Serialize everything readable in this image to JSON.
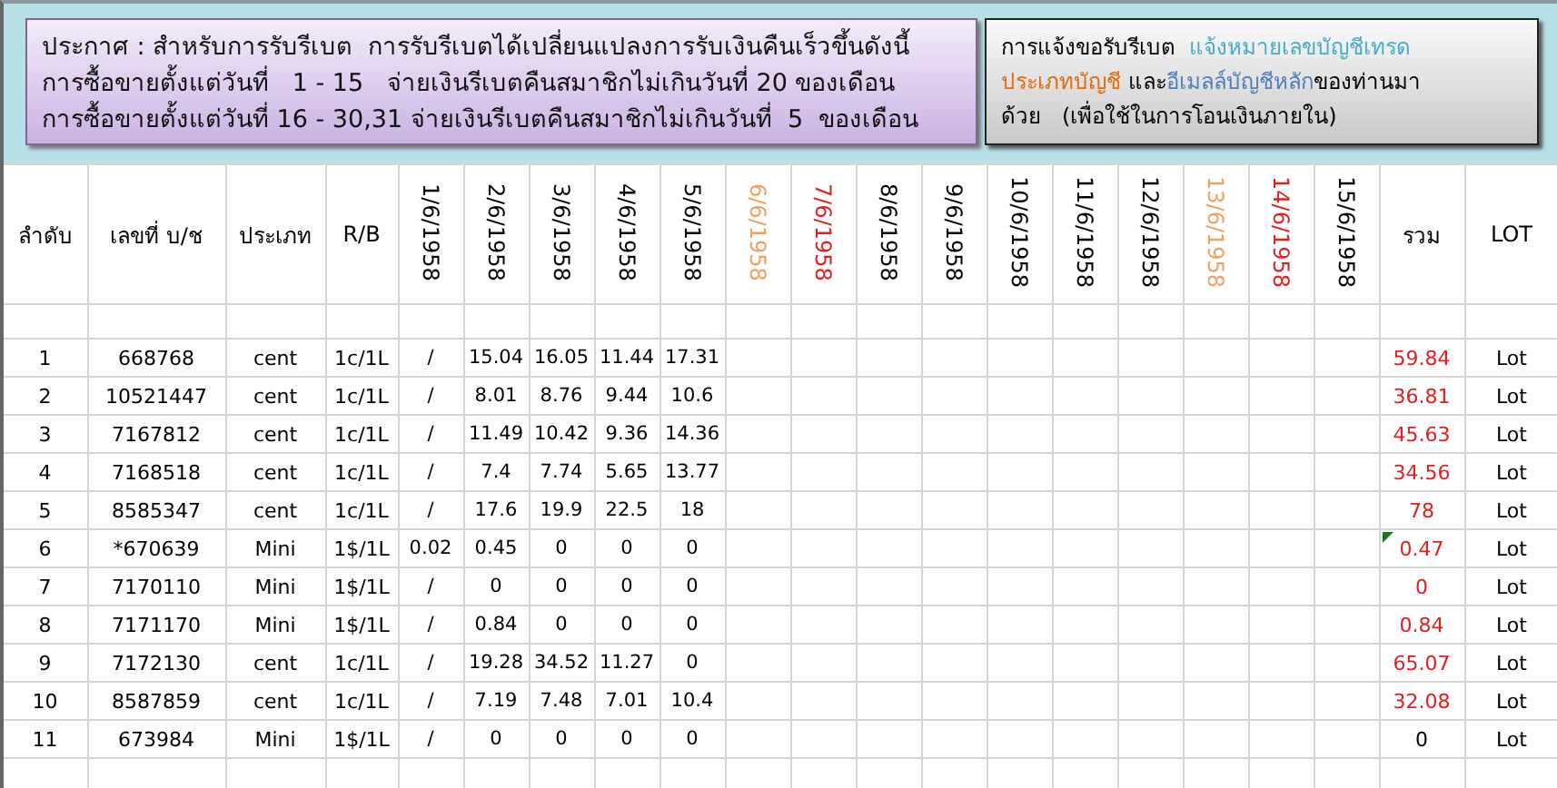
{
  "notice": {
    "lines": [
      "ประกาศ : สำหรับการรับรีเบต  การรับรีเบตได้เปลี่ยนแปลงการรับเงินคืนเร็วขึ้นดังนี้",
      "การซื้อขายตั้งแต่วันที่   1 - 15   จ่ายเงินรีเบตคืนสมาชิกไม่เกินวันที่ 20 ของเดือน",
      "การซื้อขายตั้งแต่วันที่ 16 - 30,31 จ่ายเงินรีเบตคืนสมาชิกไม่เกินวันที่  5  ของเดือน"
    ]
  },
  "request_note": {
    "lines": [
      [
        {
          "text": "การแจ้งขอรับรีเบต  ",
          "color": "#000000"
        },
        {
          "text": "แจ้งหมายเลขบัญชีเทรด",
          "color": "#4bacc6"
        }
      ],
      [
        {
          "text": "ประเภทบัญชี",
          "color": "#e46c0a"
        },
        {
          "text": " และ",
          "color": "#000000"
        },
        {
          "text": "อีเมลล์บัญชีหลัก",
          "color": "#4f81bd"
        },
        {
          "text": "ของท่านมา",
          "color": "#000000"
        }
      ],
      [
        {
          "text": "ด้วย   (เพื่อใช้ในการโอนเงินภายใน)",
          "color": "#000000"
        }
      ]
    ]
  },
  "table": {
    "columns": [
      {
        "label": "ลำดับ",
        "kind": "plain"
      },
      {
        "label": "เลขที่ บ/ช",
        "kind": "plain"
      },
      {
        "label": "ประเภท",
        "kind": "plain"
      },
      {
        "label": "R/B",
        "kind": "plain"
      },
      {
        "label": "1/6/1958",
        "kind": "date",
        "color": "#000000"
      },
      {
        "label": "2/6/1958",
        "kind": "date",
        "color": "#000000"
      },
      {
        "label": "3/6/1958",
        "kind": "date",
        "color": "#000000"
      },
      {
        "label": "4/6/1958",
        "kind": "date",
        "color": "#000000"
      },
      {
        "label": "5/6/1958",
        "kind": "date",
        "color": "#000000"
      },
      {
        "label": "6/6/1958",
        "kind": "date",
        "color": "#f0a060"
      },
      {
        "label": "7/6/1958",
        "kind": "date",
        "color": "#e02020"
      },
      {
        "label": "8/6/1958",
        "kind": "date",
        "color": "#000000"
      },
      {
        "label": "9/6/1958",
        "kind": "date",
        "color": "#000000"
      },
      {
        "label": "10/6/1958",
        "kind": "date",
        "color": "#000000"
      },
      {
        "label": "11/6/1958",
        "kind": "date",
        "color": "#000000"
      },
      {
        "label": "12/6/1958",
        "kind": "date",
        "color": "#000000"
      },
      {
        "label": "13/6/1958",
        "kind": "date",
        "color": "#f0a060"
      },
      {
        "label": "14/6/1958",
        "kind": "date",
        "color": "#e02020"
      },
      {
        "label": "15/6/1958",
        "kind": "date",
        "color": "#000000"
      },
      {
        "label": "รวม",
        "kind": "plain"
      },
      {
        "label": "LOT",
        "kind": "plain"
      }
    ],
    "rows": [
      {
        "no": "1",
        "account": "668768",
        "type": "cent",
        "rb": "1c/1L",
        "days": [
          "/",
          "15.04",
          "16.05",
          "11.44",
          "17.31"
        ],
        "total": "59.84",
        "color": "#e02020",
        "flagged": false,
        "lot": "Lot"
      },
      {
        "no": "2",
        "account": "10521447",
        "type": "cent",
        "rb": "1c/1L",
        "days": [
          "/",
          "8.01",
          "8.76",
          "9.44",
          "10.6"
        ],
        "total": "36.81",
        "color": "#e02020",
        "flagged": false,
        "lot": "Lot"
      },
      {
        "no": "3",
        "account": "7167812",
        "type": "cent",
        "rb": "1c/1L",
        "days": [
          "/",
          "11.49",
          "10.42",
          "9.36",
          "14.36"
        ],
        "total": "45.63",
        "color": "#e02020",
        "flagged": false,
        "lot": "Lot"
      },
      {
        "no": "4",
        "account": "7168518",
        "type": "cent",
        "rb": "1c/1L",
        "days": [
          "/",
          "7.4",
          "7.74",
          "5.65",
          "13.77"
        ],
        "total": "34.56",
        "color": "#e02020",
        "flagged": false,
        "lot": "Lot"
      },
      {
        "no": "5",
        "account": "8585347",
        "type": "cent",
        "rb": "1c/1L",
        "days": [
          "/",
          "17.6",
          "19.9",
          "22.5",
          "18"
        ],
        "total": "78",
        "color": "#e02020",
        "flagged": false,
        "lot": "Lot"
      },
      {
        "no": "6",
        "account": "*670639",
        "type": "Mini",
        "rb": "1$/1L",
        "days": [
          "0.02",
          "0.45",
          "0",
          "0",
          "0"
        ],
        "total": "0.47",
        "color": "#e02020",
        "flagged": true,
        "lot": "Lot"
      },
      {
        "no": "7",
        "account": "7170110",
        "type": "Mini",
        "rb": "1$/1L",
        "days": [
          "/",
          "0",
          "0",
          "0",
          "0"
        ],
        "total": "0",
        "color": "#e02020",
        "flagged": false,
        "lot": "Lot"
      },
      {
        "no": "8",
        "account": "7171170",
        "type": "Mini",
        "rb": "1$/1L",
        "days": [
          "/",
          "0.84",
          "0",
          "0",
          "0"
        ],
        "total": "0.84",
        "color": "#e02020",
        "flagged": false,
        "lot": "Lot"
      },
      {
        "no": "9",
        "account": "7172130",
        "type": "cent",
        "rb": "1c/1L",
        "days": [
          "/",
          "19.28",
          "34.52",
          "11.27",
          "0"
        ],
        "total": "65.07",
        "color": "#e02020",
        "flagged": false,
        "lot": "Lot"
      },
      {
        "no": "10",
        "account": "8587859",
        "type": "cent",
        "rb": "1c/1L",
        "days": [
          "/",
          "7.19",
          "7.48",
          "7.01",
          "10.4"
        ],
        "total": "32.08",
        "color": "#e02020",
        "flagged": false,
        "lot": "Lot"
      },
      {
        "no": "11",
        "account": "673984",
        "type": "Mini",
        "rb": "1$/1L",
        "days": [
          "/",
          "0",
          "0",
          "0",
          "0"
        ],
        "total": "0",
        "color": "#000000",
        "flagged": false,
        "lot": "Lot"
      }
    ]
  }
}
